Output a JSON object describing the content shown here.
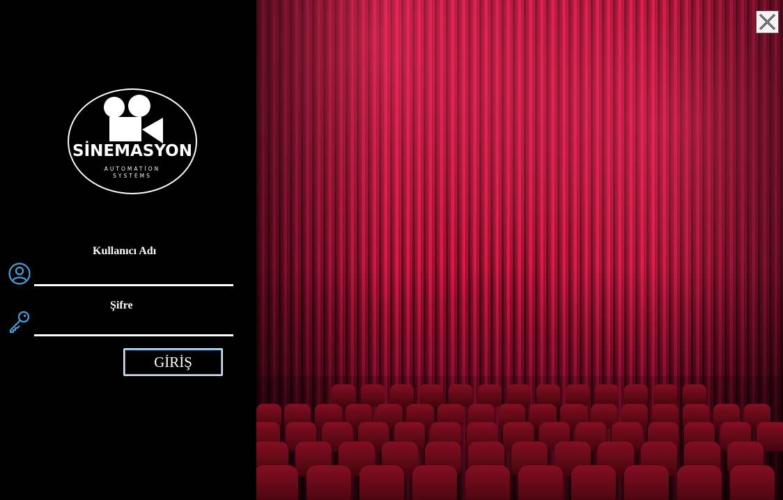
{
  "brand": {
    "name": "SİNEMASYON",
    "subtitle_line1": "AUTOMATİON",
    "subtitle_line2": "SYSTEMS"
  },
  "login_form": {
    "username_label": "Kullanıcı Adı",
    "username_value": "",
    "password_label": "Şifre",
    "password_value": "",
    "submit_label": "GİRİŞ"
  },
  "icons": {
    "user": "user-circle-icon",
    "password": "key-icon",
    "close": "close-icon"
  },
  "colors": {
    "background": "#000000",
    "icon_accent": "#3fa2dc",
    "curtain": "#c8103a",
    "seat": "#7a0c1c"
  }
}
